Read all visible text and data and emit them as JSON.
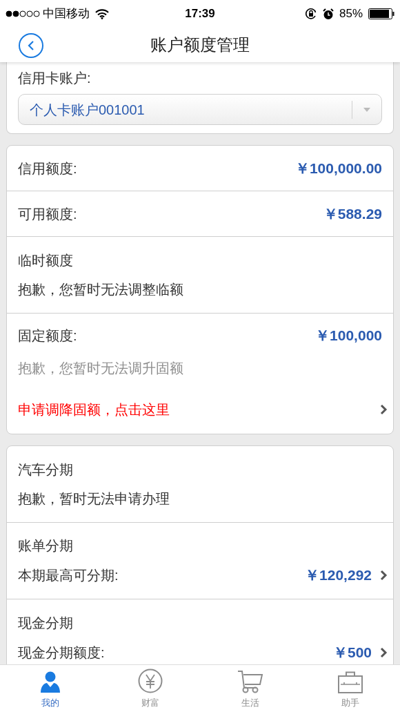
{
  "status_bar": {
    "carrier": "中国移动",
    "time": "17:39",
    "battery": "85%"
  },
  "header": {
    "title": "账户额度管理"
  },
  "account": {
    "label": "信用卡账户:",
    "value": "个人卡账户001001"
  },
  "limits": [
    {
      "kind": "amount",
      "label": "信用额度:",
      "value": "￥100,000.00"
    },
    {
      "kind": "amount",
      "label": "可用额度:",
      "value": "￥588.29"
    },
    {
      "kind": "notice",
      "label": "临时额度",
      "note": "抱歉，您暂时无法调整临额"
    },
    {
      "kind": "fixed",
      "label": "固定额度:",
      "value": "￥100,000",
      "note": "抱歉，您暂时无法调升固额",
      "link": "申请调降固额，点击这里"
    }
  ],
  "installments": [
    {
      "kind": "notice",
      "label": "汽车分期",
      "note": "抱歉，暂时无法申请办理"
    },
    {
      "kind": "installment",
      "label": "账单分期",
      "sublabel": "本期最高可分期:",
      "value": "￥120,292"
    },
    {
      "kind": "installment",
      "label": "现金分期",
      "sublabel": "现金分期额度:",
      "value": "￥500"
    }
  ],
  "tab_bar": [
    {
      "label": "我的",
      "selected": true
    },
    {
      "label": "财富",
      "selected": false
    },
    {
      "label": "生活",
      "selected": false
    },
    {
      "label": "助手",
      "selected": false
    }
  ]
}
